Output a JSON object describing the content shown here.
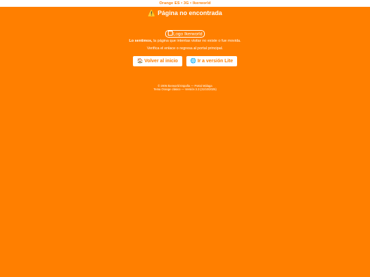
{
  "topbar": {
    "text": "Orange ES • 3G • Ikerworld"
  },
  "page": {
    "title_icon": "warning-icon",
    "title": "Página no encontrada",
    "logo_alt": "Logo Ikerworld",
    "message_bold": "Lo sentimos,",
    "message_rest": " la página que intentas visitar no existe o fue movida.",
    "message_line2": "Verifica el enlace o regresa al portal principal."
  },
  "buttons": {
    "home_label": "Volver al inicio",
    "home_icon": "house-icon",
    "lite_label": "Ir a versión Lite",
    "lite_icon": "globe-icon"
  },
  "footer": {
    "line1": "© 2005 Ikerworld España — Portal Málaga",
    "line2": "Tema Orange clásico — Versión 3.3 (31/10/2025)"
  },
  "colors": {
    "background": "#ff7f00",
    "accent": "#ffffff"
  }
}
